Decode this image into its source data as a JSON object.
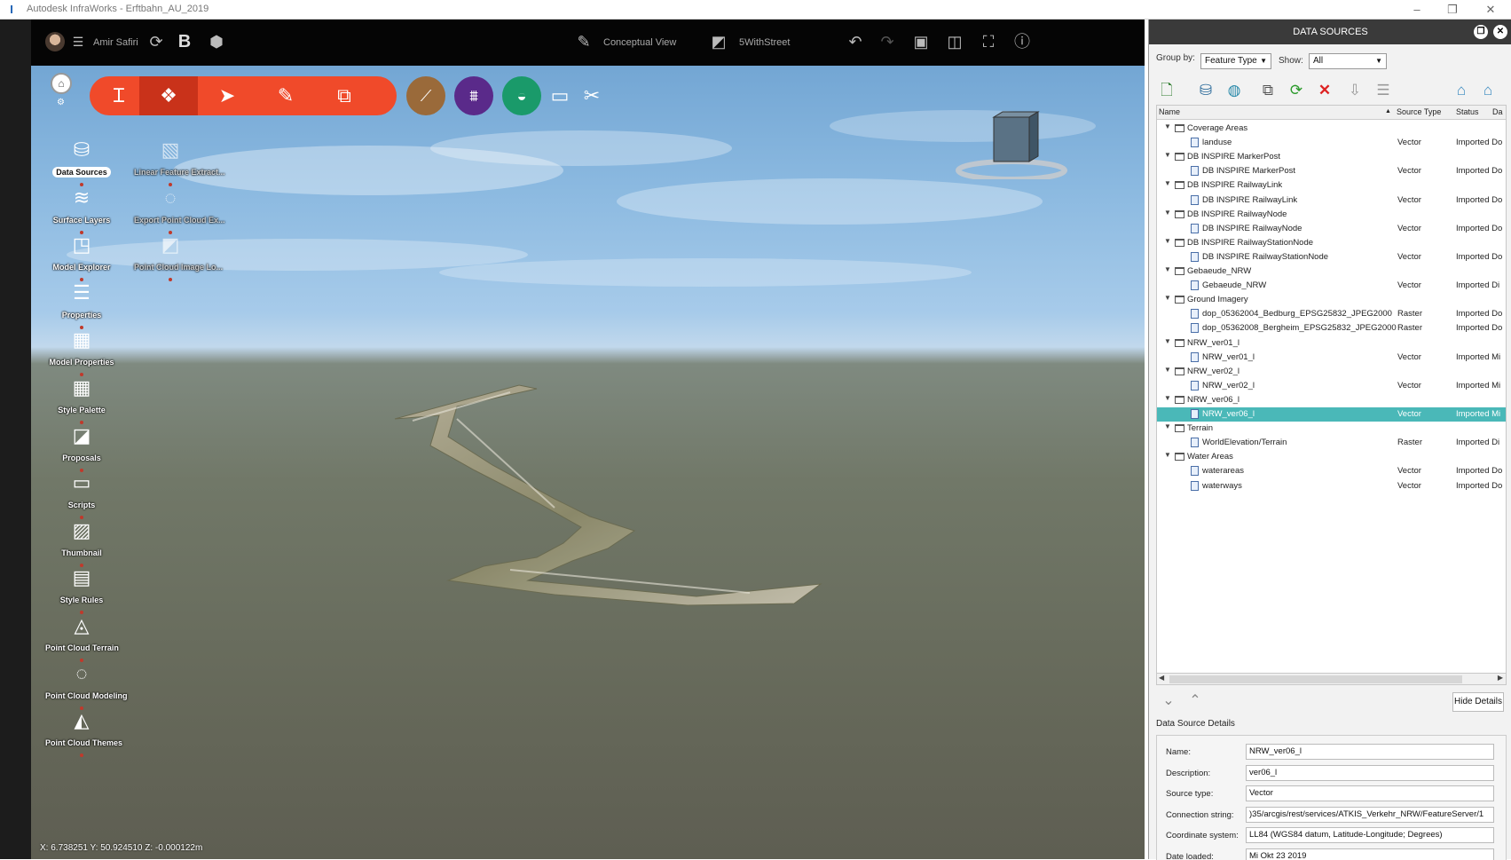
{
  "window": {
    "title": "Autodesk InfraWorks - Erftbahn_AU_2019"
  },
  "topbar": {
    "user": "Amir Safiri",
    "bold_letter": "B",
    "view_mode": "Conceptual View",
    "bookmark": "5WithStreet"
  },
  "sidebar": {
    "items": [
      {
        "label": "Data Sources",
        "icon": "database-icon",
        "active": true
      },
      {
        "label": "Surface Layers",
        "icon": "layers-icon"
      },
      {
        "label": "Model Explorer",
        "icon": "model-explorer-icon"
      },
      {
        "label": "Properties",
        "icon": "properties-icon"
      },
      {
        "label": "Model Properties",
        "icon": "model-properties-icon"
      },
      {
        "label": "Style Palette",
        "icon": "style-palette-icon"
      },
      {
        "label": "Proposals",
        "icon": "proposals-icon"
      },
      {
        "label": "Scripts",
        "icon": "scripts-icon"
      },
      {
        "label": "Thumbnail",
        "icon": "thumbnail-icon"
      },
      {
        "label": "Style Rules",
        "icon": "style-rules-icon"
      },
      {
        "label": "Point Cloud Terrain",
        "icon": "point-cloud-terrain-icon"
      },
      {
        "label": "Point Cloud Modeling",
        "icon": "point-cloud-modeling-icon"
      },
      {
        "label": "Point Cloud Themes",
        "icon": "point-cloud-themes-icon"
      }
    ],
    "items2": [
      {
        "label": "Linear Feature Extract...",
        "icon": "linear-feature-icon"
      },
      {
        "label": "Export Point Cloud Ex...",
        "icon": "export-point-cloud-icon"
      },
      {
        "label": "Point Cloud Image Lo...",
        "icon": "point-cloud-image-icon"
      }
    ]
  },
  "viewport": {
    "coords": "X: 6.738251 Y: 50.924510 Z: -0.000122m"
  },
  "panel": {
    "title": "DATA SOURCES",
    "group_by_label": "Group by:",
    "group_by_value": "Feature Type",
    "show_label": "Show:",
    "show_value": "All",
    "columns": {
      "name": "Name",
      "source_type": "Source Type",
      "status": "Status",
      "da": "Da"
    },
    "tree": [
      {
        "kind": "group",
        "name": "Coverage Areas"
      },
      {
        "kind": "item",
        "name": "landuse",
        "type": "Vector",
        "status": "Imported Do"
      },
      {
        "kind": "group",
        "name": "DB INSPIRE MarkerPost"
      },
      {
        "kind": "item",
        "name": "DB INSPIRE MarkerPost",
        "type": "Vector",
        "status": "Imported Do"
      },
      {
        "kind": "group",
        "name": "DB INSPIRE RailwayLink"
      },
      {
        "kind": "item",
        "name": "DB INSPIRE RailwayLink",
        "type": "Vector",
        "status": "Imported Do"
      },
      {
        "kind": "group",
        "name": "DB INSPIRE RailwayNode"
      },
      {
        "kind": "item",
        "name": "DB INSPIRE RailwayNode",
        "type": "Vector",
        "status": "Imported Do"
      },
      {
        "kind": "group",
        "name": "DB INSPIRE RailwayStationNode"
      },
      {
        "kind": "item",
        "name": "DB INSPIRE RailwayStationNode",
        "type": "Vector",
        "status": "Imported Do"
      },
      {
        "kind": "group",
        "name": "Gebaeude_NRW"
      },
      {
        "kind": "item",
        "name": "Gebaeude_NRW",
        "type": "Vector",
        "status": "Imported Di"
      },
      {
        "kind": "group",
        "name": "Ground Imagery"
      },
      {
        "kind": "item",
        "name": "dop_05362004_Bedburg_EPSG25832_JPEG2000",
        "type": "Raster",
        "status": "Imported Do"
      },
      {
        "kind": "item",
        "name": "dop_05362008_Bergheim_EPSG25832_JPEG2000",
        "type": "Raster",
        "status": "Imported Do"
      },
      {
        "kind": "group",
        "name": "NRW_ver01_l"
      },
      {
        "kind": "item",
        "name": "NRW_ver01_l",
        "type": "Vector",
        "status": "Imported Mi"
      },
      {
        "kind": "group",
        "name": "NRW_ver02_l"
      },
      {
        "kind": "item",
        "name": "NRW_ver02_l",
        "type": "Vector",
        "status": "Imported Mi"
      },
      {
        "kind": "group",
        "name": "NRW_ver06_l"
      },
      {
        "kind": "item",
        "name": "NRW_ver06_l",
        "type": "Vector",
        "status": "Imported Mi",
        "selected": true
      },
      {
        "kind": "group",
        "name": "Terrain"
      },
      {
        "kind": "item",
        "name": "WorldElevation/Terrain",
        "type": "Raster",
        "status": "Imported Di"
      },
      {
        "kind": "group",
        "name": "Water Areas"
      },
      {
        "kind": "item",
        "name": "waterareas",
        "type": "Vector",
        "status": "Imported Do"
      },
      {
        "kind": "item",
        "name": "waterways",
        "type": "Vector",
        "status": "Imported Do"
      }
    ],
    "hide_details": "Hide Details",
    "details_title": "Data Source Details",
    "details": [
      {
        "label": "Name:",
        "value": "NRW_ver06_l"
      },
      {
        "label": "Description:",
        "value": "ver06_l"
      },
      {
        "label": "Source type:",
        "value": "Vector"
      },
      {
        "label": "Connection string:",
        "value": ")35/arcgis/rest/services/ATKIS_Verkehr_NRW/FeatureServer/1"
      },
      {
        "label": "Coordinate system:",
        "value": "LL84 (WGS84 datum, Latitude-Longitude; Degrees)"
      },
      {
        "label": "Date loaded:",
        "value": "Mi Okt 23 2019"
      }
    ]
  },
  "colors": {
    "accent_red": "#f04a2a",
    "selection": "#4ab8b8",
    "panel_header": "#3a3a3a"
  }
}
